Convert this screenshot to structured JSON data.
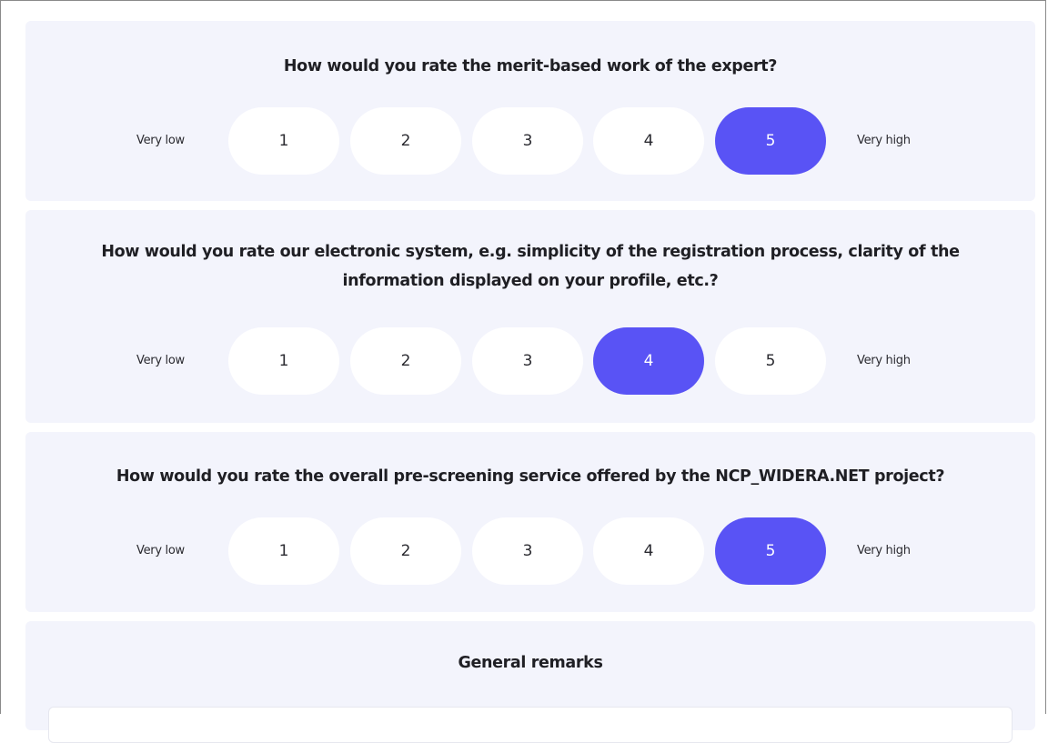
{
  "scale": {
    "low_label": "Very low",
    "high_label": "Very high",
    "options": [
      "1",
      "2",
      "3",
      "4",
      "5"
    ]
  },
  "questions": [
    {
      "lines": [
        "How would you rate the merit-based work of the expert?"
      ],
      "selected": "5"
    },
    {
      "lines": [
        "How would you rate our electronic system, e.g. simplicity of the registration process, clarity of the",
        "information displayed on your profile, etc.?"
      ],
      "selected": "4"
    },
    {
      "lines": [
        "How would you rate the overall pre-screening service offered by the NCP_WIDERA.NET project?"
      ],
      "selected": "5"
    }
  ],
  "remarks": {
    "title": "General remarks",
    "value": ""
  },
  "colors": {
    "card_background": "#f3f4fc",
    "selected_option": "#5953f5",
    "option_background": "#ffffff"
  }
}
